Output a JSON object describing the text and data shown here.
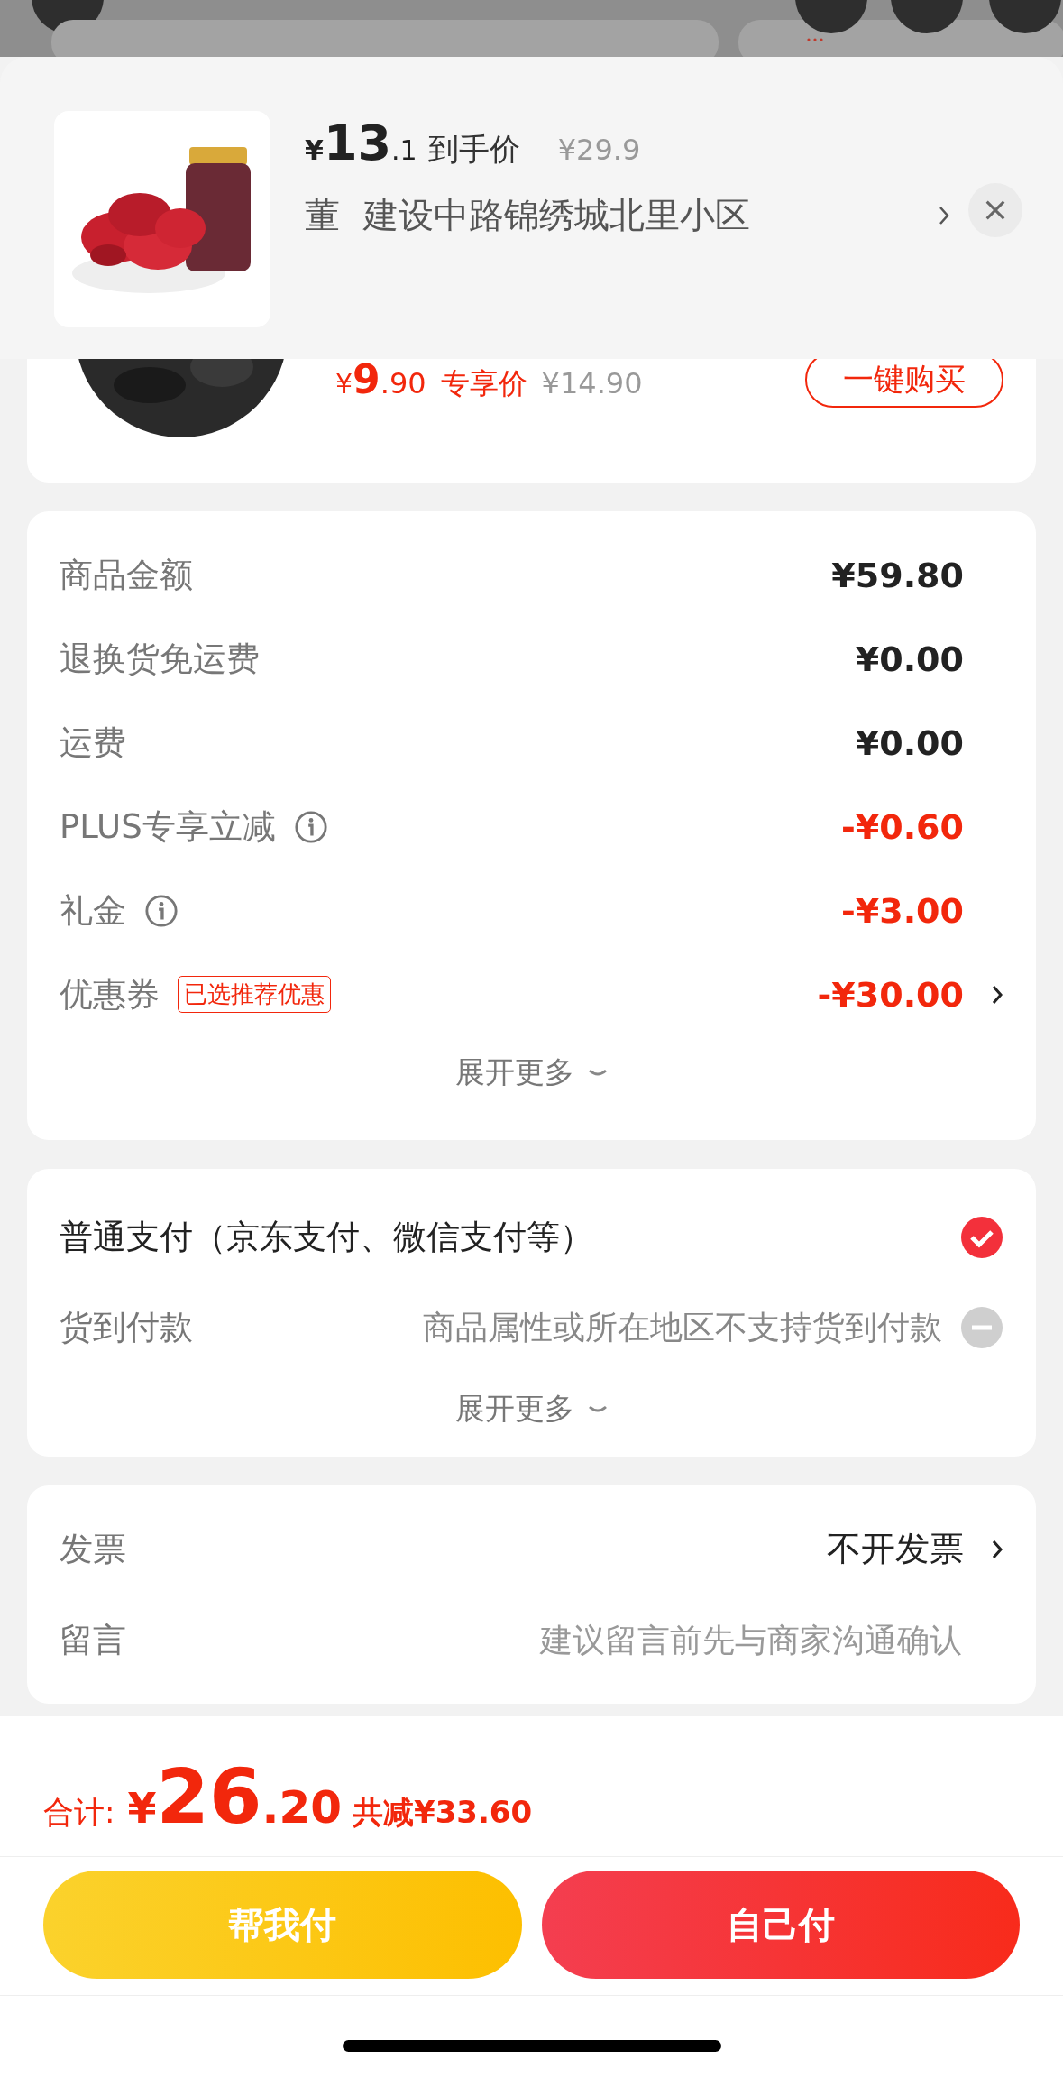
{
  "popup": {
    "price_symbol": "¥",
    "price_integer": "13",
    "price_decimal": ".1",
    "price_label": "到手价",
    "original_price": "¥29.9",
    "recipient": "董",
    "address": "建设中路锦绣城北里小区"
  },
  "recommended_item": {
    "price_symbol": "¥",
    "price_integer": "9",
    "price_decimal": ".90",
    "price_label": "专享价",
    "original_price": "¥14.90",
    "button": "一键购买"
  },
  "summary": {
    "rows": [
      {
        "label": "商品金额",
        "value": "¥59.80",
        "kind": "amount"
      },
      {
        "label": "退换货免运费",
        "value": "¥0.00",
        "kind": "amount"
      },
      {
        "label": "运费",
        "value": "¥0.00",
        "kind": "amount"
      },
      {
        "label": "PLUS专享立减",
        "value": "-¥0.60",
        "kind": "discount",
        "info": true
      },
      {
        "label": "礼金",
        "value": "-¥3.00",
        "kind": "discount",
        "info": true
      },
      {
        "label": "优惠券",
        "value": "-¥30.00",
        "kind": "discount",
        "tag": "已选推荐优惠",
        "chevron": true
      }
    ],
    "expand": "展开更多"
  },
  "payment": {
    "options": [
      {
        "label": "普通支付（京东支付、微信支付等）",
        "selected": true,
        "disabled": false
      },
      {
        "label": "货到付款",
        "note": "商品属性或所在地区不支持货到付款",
        "selected": false,
        "disabled": true
      }
    ],
    "expand": "展开更多"
  },
  "extras": {
    "rows": [
      {
        "kind": "value",
        "label": "发票",
        "value": "不开发票",
        "chevron": true
      },
      {
        "kind": "input",
        "label": "留言",
        "placeholder": "建议留言前先与商家沟通确认"
      }
    ]
  },
  "footer": {
    "total_label": "合计:",
    "total_symbol": "¥",
    "total_integer": "26",
    "total_decimal": ".20",
    "saved": "共减¥33.60",
    "buttons": [
      {
        "label": "帮我付",
        "kind": "friend"
      },
      {
        "label": "自己付",
        "kind": "self"
      }
    ]
  }
}
